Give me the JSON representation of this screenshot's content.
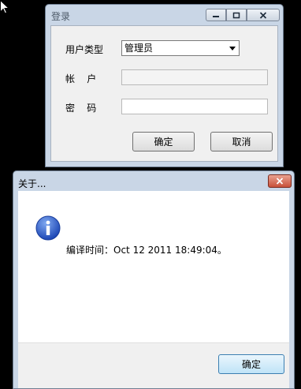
{
  "login_window": {
    "title": "登录",
    "user_type_label": "用户类型",
    "user_type_value": "管理员",
    "account_label": "帐    户",
    "account_value": "",
    "password_label": "密    码",
    "password_value": "",
    "ok_label": "确定",
    "cancel_label": "取消"
  },
  "about_dialog": {
    "title": "关于...",
    "message": "编译时间：Oct 12 2011 18:49:04。",
    "ok_label": "确定"
  },
  "icons": {
    "cursor": "mouse-pointer",
    "info": "information-icon",
    "minimize": "minimize-icon",
    "maximize": "maximize-icon",
    "close": "close-icon"
  },
  "colors": {
    "desktop": "#000000",
    "frame": "#c9d6e6",
    "close_button": "#c8513a"
  }
}
